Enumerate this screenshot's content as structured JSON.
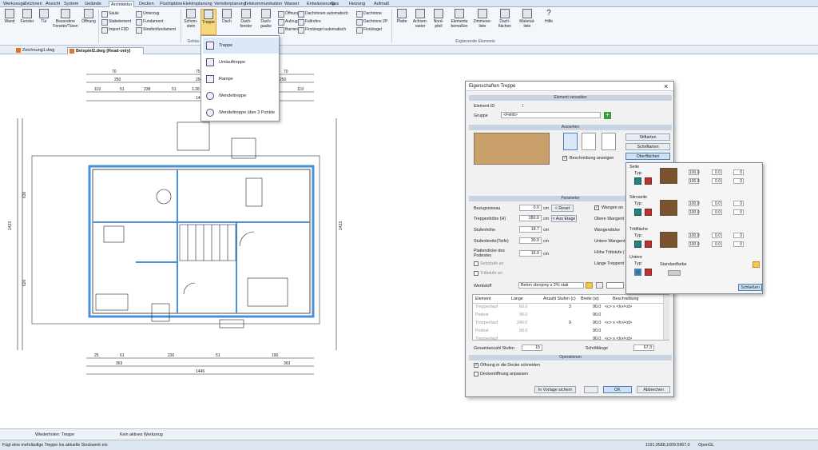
{
  "ribbon_tabs": [
    "Werkzeuge",
    "Zeichnen",
    "Ansicht",
    "System",
    "Gelände",
    "Architektur",
    "Decken",
    "Fluchtpläne",
    "Elektroplanung",
    "Verteilerplanung",
    "Telekommunikation",
    "Wasser",
    "Entwässerung",
    "Gas",
    "Heizung",
    "Aufmaß"
  ],
  "ribbon_active_tab": "Architektur",
  "ribbon_left": {
    "wand": "Wand",
    "fenster": "Fenster",
    "tuer": "Tür",
    "besondere": "Besondere Fenster/Türen",
    "oeffnung": "Öffnung",
    "saeule": "Säule",
    "stabelement": "Stabelement",
    "import_f3d": "Import F3D",
    "unterzug": "Unterzug",
    "fundament": "Fundament",
    "streifenfundament": "Streifenfundament"
  },
  "ribbon_mid": {
    "schornstein": "Schorn-stein",
    "treppe": "Treppe",
    "dach": "Dach",
    "dachfenster": "Dach-fenster",
    "dachgaube": "Dach-gaube",
    "oeffnung": "Öffnung",
    "aufzug": "Aufzug",
    "barriere": "Barriere",
    "dachrinnen_auto": "Dachrinnen automatisch",
    "fallrohre": "Fallrohre",
    "firstziegel_auto": "Firstziegel automatisch",
    "dachrinne": "Dachrinne",
    "dachrinne2p": "Dachrinne 2P",
    "firstziegel": "Firstziegel",
    "group_label": "Gebäu"
  },
  "ribbon_right": {
    "platte": "Platte",
    "achsenraster": "Achsen-raster",
    "nordpfeil": "Nord-pfeil",
    "elemente_bemassen": "Elemente bemaßen",
    "zimmerer_liste": "Zimmerer-liste",
    "dachflaechen": "Dach-flächen",
    "materialliste": "Material-liste",
    "hilfe": "Hilfe",
    "group_label": "Ergänzende Elemente"
  },
  "doc_tabs": [
    "Zeichnung1.dwg",
    "Beispiel2.dwg (Read-only)"
  ],
  "treppe_menu": [
    "Treppe",
    "Umlauftreppe",
    "Rampe",
    "Wendeltreppe",
    "Wendeltreppe über 3 Punkte"
  ],
  "dialog": {
    "title": "Eigenschaften Treppe",
    "close": "×",
    "sec_element": "Element verwalten",
    "element_id_label": "Element ID",
    "element_id_value": "1",
    "gruppe_label": "Gruppe",
    "gruppe_value": "<Fehlt>",
    "sec_aussehen": "Aussehen",
    "btn_stiftarten": "Stiftarten",
    "btn_schriftarten": "Schriftarten",
    "btn_oberflaechen": "Oberflächen",
    "beschreibung_anzeigen": "Beschreibung anzeigen",
    "sec_parameter": "Parameter",
    "params": [
      {
        "label": "Bezugsniveau",
        "value": "0.0",
        "unit": "cm"
      },
      {
        "label": "Treppenhöhe (H)",
        "value": "280.0",
        "unit": "cm"
      },
      {
        "label": "Stufenhöhe",
        "value": "18.7",
        "unit": "cm"
      },
      {
        "label": "Stufenbreite(Tiefe)",
        "value": "30.0",
        "unit": "cm"
      },
      {
        "label": "Plattendicke des Podestes",
        "value": "16.0",
        "unit": "cm"
      }
    ],
    "btn_reset": "< Reset",
    "btn_aus_etage": "< Aus Etage",
    "setzstufe": "Setzstufe an",
    "trittstufe": "Trittstufe an",
    "wangen_an": "Wangen an",
    "right_labels": [
      "Obere Wangent",
      "Wangendicke",
      "Untere Wangent",
      "Höhe Trittstufe (",
      "Länge Treppent"
    ],
    "werkstoff_label": "Werkstoff",
    "werkstoff_value": "Beton zbrojony z 2% stali",
    "table_headers": [
      "Element",
      "Länge",
      "Anzahl Stufen (c)",
      "Breite (w)",
      "Beschreibung"
    ],
    "table_rows": [
      {
        "element": "Treppenlauf",
        "laenge": "60.0",
        "stufen": "3",
        "breite": "90.0",
        "beschr": "<c> x <h>/<d>"
      },
      {
        "element": "Podest",
        "laenge": "90.0",
        "stufen": "",
        "breite": "90.0",
        "beschr": ""
      },
      {
        "element": "Treppenlauf",
        "laenge": "240.0",
        "stufen": "9",
        "breite": "90.0",
        "beschr": "<c> x <h>/<d>"
      },
      {
        "element": "Podest",
        "laenge": "90.0",
        "stufen": "",
        "breite": "90.0",
        "beschr": ""
      },
      {
        "element": "Treppenlauf",
        "laenge": "",
        "stufen": "",
        "breite": "90.0",
        "beschr": "<c> x <h>/<d>"
      }
    ],
    "gesamt_label": "Gesamtanzahl Stufen",
    "gesamt_value": "15",
    "schrittlaenge_label": "Schrittlänge",
    "schrittlaenge_value": "67.3",
    "sec_operationen": "Operationen",
    "op1": "Öffnung in die Decke schneiden",
    "op2": "Deckenöffnung anpassen",
    "btn_vorlage": "In Vorlage sichern",
    "btn_ok": "OK",
    "btn_abbrechen": "Abbrechen"
  },
  "surfaces": {
    "sections": [
      {
        "title": "Seite",
        "typ": "Typ:"
      },
      {
        "title": "Stirnseite",
        "typ": "Typ:"
      },
      {
        "title": "Trittfläche",
        "typ": "Typ:"
      }
    ],
    "row1": [
      "100.0",
      "0.0",
      "0"
    ],
    "row2": [
      "100.0",
      "0.0",
      "0"
    ],
    "untere_title": "Untere",
    "untere_typ": "Typ:",
    "standardfarbe": "Standardfarbe",
    "btn_schliessen": "Schließen",
    "wood_color": "#7a5230"
  },
  "status": {
    "wiederholen": "Wiederholen: Treppe",
    "werkzeug": "Kein aktives Werkzeug",
    "hint": "Fügt eine mehrläufige Treppe ins aktuelle Stockwerk ein",
    "coords": "1191.9588,1609.5967,0",
    "opengl": "OpenGL"
  },
  "dims": {
    "top_row1": [
      "70",
      "75",
      "70"
    ],
    "top_row2": [
      "250",
      "250",
      "250"
    ],
    "top_row3": [
      "119",
      "51",
      "238",
      "51",
      "1.38",
      "51",
      "260",
      "51",
      "119"
    ],
    "total": "1446",
    "bottom1": [
      "25",
      "61",
      "230",
      "51",
      "190"
    ],
    "bottom2": [
      "363",
      "363"
    ],
    "left": [
      "1423",
      "630",
      "620"
    ],
    "right": [
      "1423"
    ]
  }
}
